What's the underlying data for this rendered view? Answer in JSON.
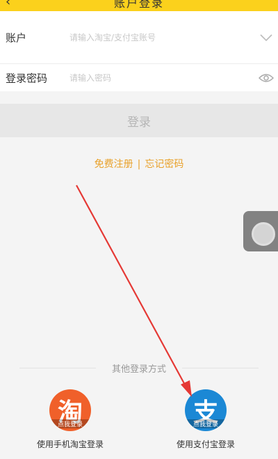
{
  "header": {
    "back_icon": "back-chevron-icon",
    "title": "账户登录"
  },
  "form": {
    "account_label": "账户",
    "account_placeholder": "请输入淘宝/支付宝账号",
    "password_label": "登录密码",
    "password_placeholder": "请输入密码"
  },
  "login_button": "登录",
  "links": {
    "register": "免费注册",
    "separator": "|",
    "forgot": "忘记密码"
  },
  "other_login": {
    "heading": "其他登录方式",
    "taobao": {
      "glyph": "淘",
      "tag": "点我登录",
      "caption": "使用手机淘宝登录"
    },
    "alipay": {
      "glyph": "支",
      "tag": "点我登录",
      "caption": "使用支付宝登录"
    }
  },
  "colors": {
    "header": "#fbd11c",
    "link": "#e9a12a",
    "taobao": "#f0602a",
    "alipay": "#1b88d5",
    "arrow": "#e53935"
  }
}
